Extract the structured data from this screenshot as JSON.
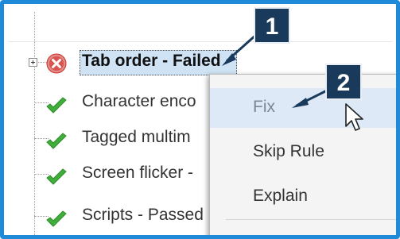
{
  "tree": {
    "items": [
      {
        "label": "Tab order - Failed",
        "status": "failed",
        "selected": true,
        "expandable": true
      },
      {
        "label": "Character enco",
        "status": "passed"
      },
      {
        "label": "Tagged multim",
        "status": "passed"
      },
      {
        "label": "Screen flicker -",
        "status": "passed"
      },
      {
        "label": "Scripts - Passed",
        "status": "passed"
      }
    ]
  },
  "context_menu": {
    "items": [
      {
        "label": "Fix",
        "hovered": true
      },
      {
        "label": "Skip Rule",
        "hovered": false
      },
      {
        "label": "Explain",
        "hovered": false
      }
    ]
  },
  "callouts": [
    {
      "label": "1"
    },
    {
      "label": "2"
    }
  ],
  "colors": {
    "frame_border": "#1f8ad8",
    "callout_bg": "#1a3a5c",
    "selection_bg": "#cfe3f5",
    "menu_hover_bg": "#dde9f6",
    "fail_icon": "#d9534f",
    "pass_icon": "#3fae3a"
  },
  "icons": {
    "fail": "x-circle-icon",
    "pass": "checkmark-icon",
    "expander": "plus-box-icon",
    "cursor": "mouse-pointer-icon"
  }
}
